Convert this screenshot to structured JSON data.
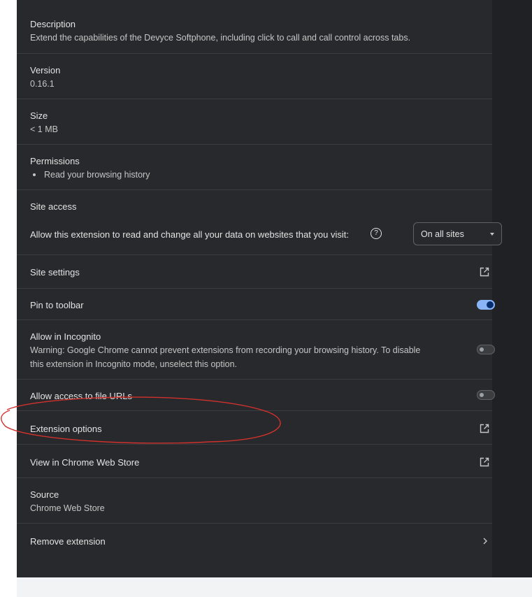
{
  "description": {
    "label": "Description",
    "text": "Extend the capabilities of the Devyce Softphone, including click to call and call control across tabs."
  },
  "version": {
    "label": "Version",
    "value": "0.16.1"
  },
  "size": {
    "label": "Size",
    "value": "< 1 MB"
  },
  "permissions": {
    "label": "Permissions",
    "items": [
      "Read your browsing history"
    ]
  },
  "site_access": {
    "label": "Site access",
    "prompt": "Allow this extension to read and change all your data on websites that you visit:",
    "help_icon": "?",
    "selected": "On all sites"
  },
  "site_settings": {
    "label": "Site settings",
    "icon": "open-in-new-icon"
  },
  "pin_toolbar": {
    "label": "Pin to toolbar",
    "enabled": true
  },
  "incognito": {
    "label": "Allow in Incognito",
    "warning_line1": "Warning: Google Chrome cannot prevent extensions from recording your browsing history. To disable",
    "warning_line2": "this extension in Incognito mode, unselect this option.",
    "enabled": false
  },
  "file_urls": {
    "label": "Allow access to file URLs",
    "enabled": false
  },
  "extension_options": {
    "label": "Extension options",
    "icon": "open-in-new-icon"
  },
  "web_store": {
    "label": "View in Chrome Web Store",
    "icon": "open-in-new-icon"
  },
  "source": {
    "label": "Source",
    "value": "Chrome Web Store"
  },
  "remove": {
    "label": "Remove extension",
    "icon": "chevron-right-icon"
  },
  "colors": {
    "background": "#28292c",
    "accent": "#8ab4f8",
    "annotation": "#d0312d"
  }
}
